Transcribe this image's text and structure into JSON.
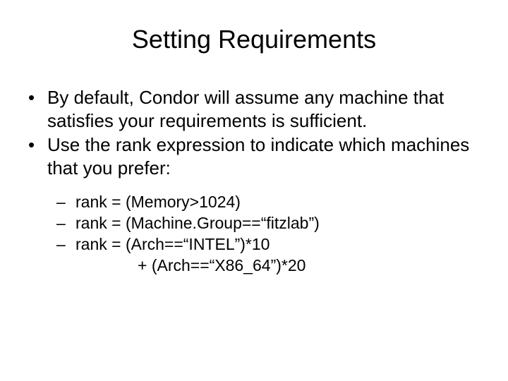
{
  "title": "Setting Requirements",
  "bullets": [
    "By default, Condor will assume any machine that satisfies your requirements is sufficient.",
    "Use the rank expression to indicate which machines that you prefer:"
  ],
  "subbullets": [
    "rank = (Memory>1024)",
    "rank = (Machine.Group==“fitzlab”)",
    "rank = (Arch==“INTEL”)*10"
  ],
  "continuation": "+ (Arch==“X86_64”)*20"
}
